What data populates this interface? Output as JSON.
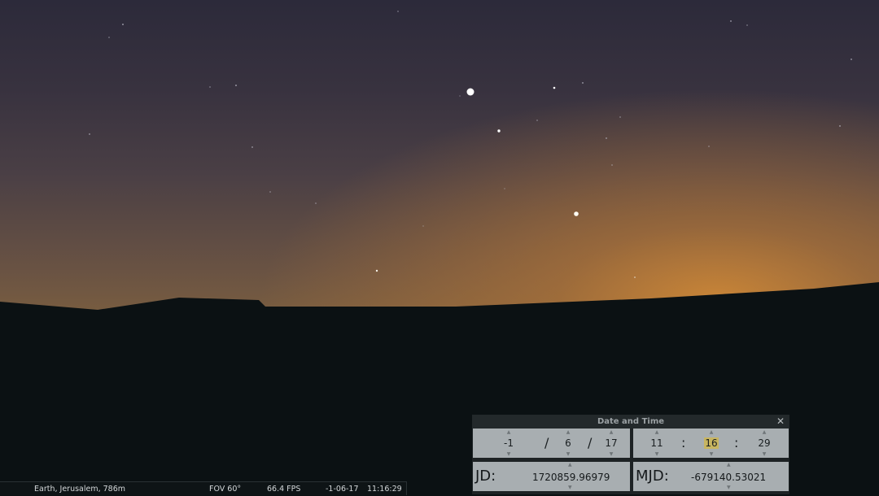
{
  "status_bar": {
    "location": "Earth, Jerusalem, 786m",
    "fov": "FOV 60°",
    "fps": "66.4 FPS",
    "date": "-1-06-17",
    "time": "11:16:29"
  },
  "date_time_dialog": {
    "title": "Date and Time",
    "close_icon": "close-icon",
    "year": "-1",
    "month": "6",
    "day": "17",
    "hour": "11",
    "minute": "16",
    "second": "29",
    "date_separator": "/",
    "time_separator": ":",
    "jd_label": "JD:",
    "jd_value": "1720859.96979",
    "mjd_label": "MJD:",
    "mjd_value": "-679140.53021",
    "spinner_up_icon": "▲",
    "spinner_down_icon": "▼"
  },
  "colors": {
    "horizon_glow": "#b07a3a",
    "sky_top": "#2c2a3a",
    "ground": "#0b1113",
    "dialog_bg": "#1d2224",
    "panel_bg": "#a8aeb1",
    "highlight": "#c8b560"
  }
}
